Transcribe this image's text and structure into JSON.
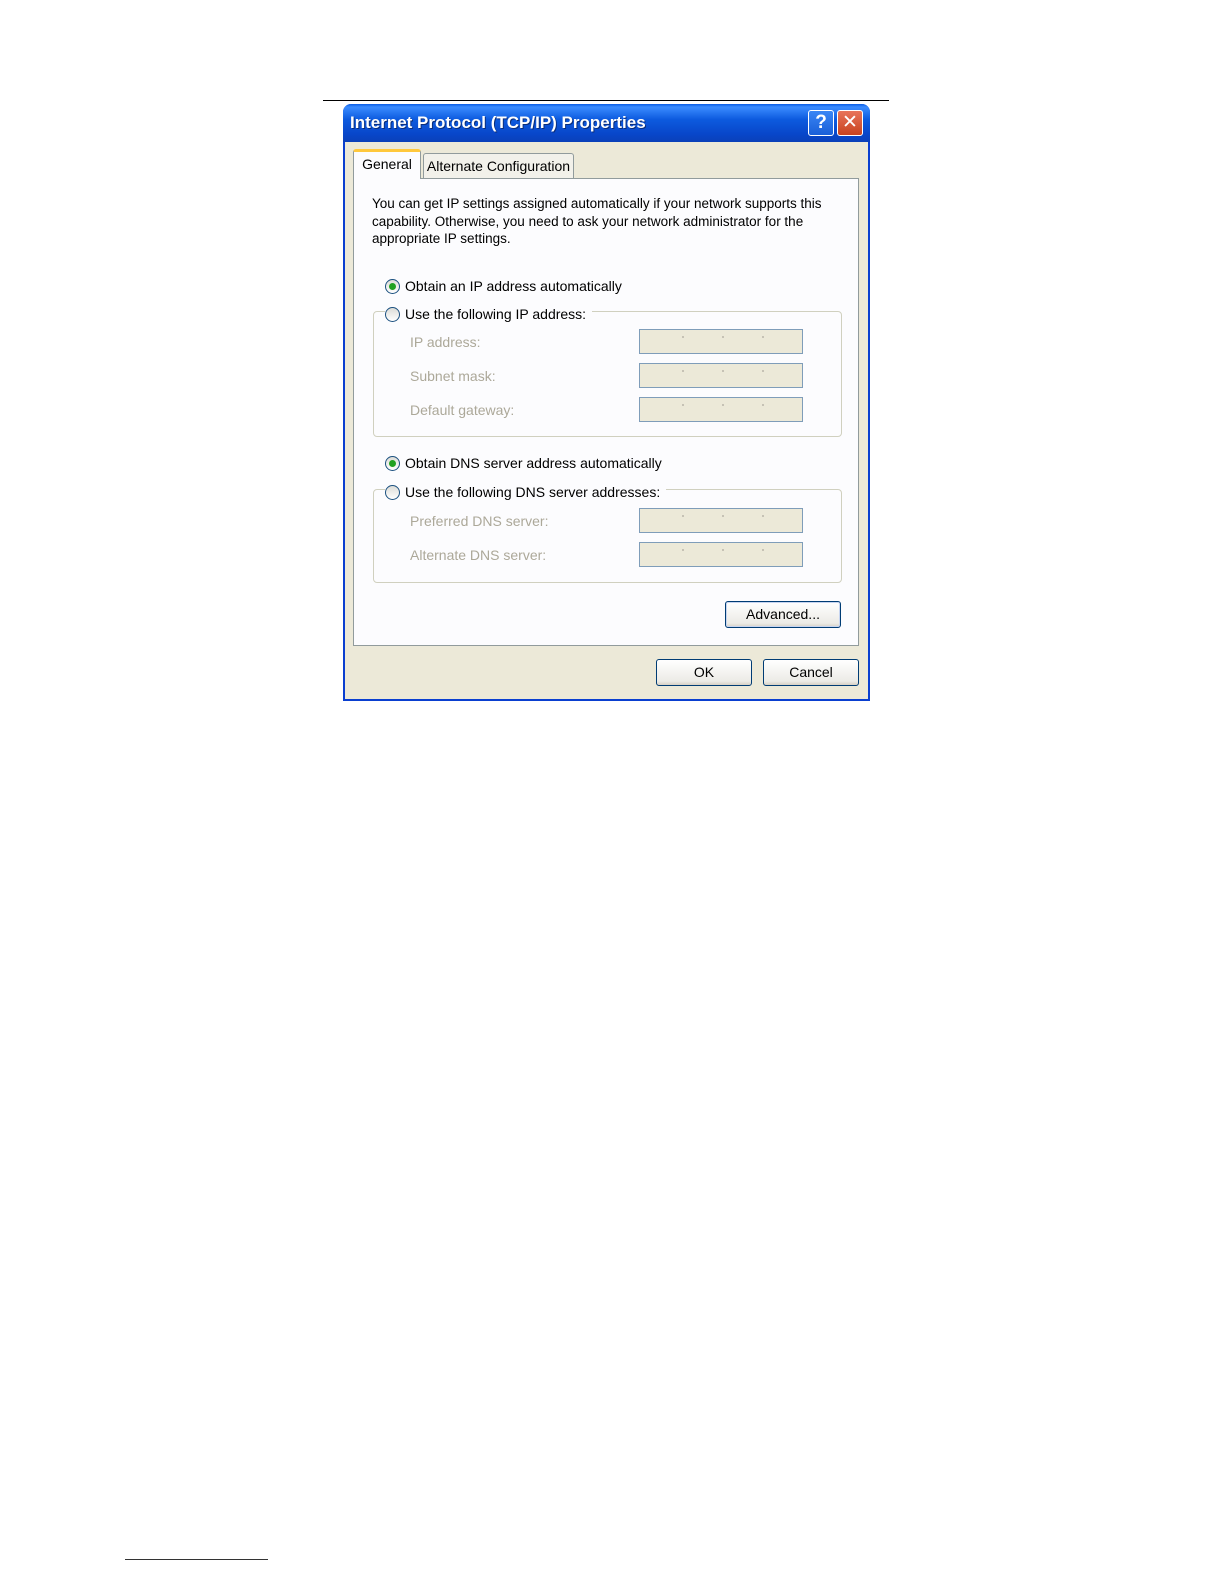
{
  "dialog": {
    "title": "Internet Protocol (TCP/IP) Properties",
    "help_symbol": "?",
    "close_symbol": "✕",
    "tabs": [
      {
        "label": "General",
        "active": true
      },
      {
        "label": "Alternate Configuration",
        "active": false
      }
    ],
    "intro": "You can get IP settings assigned automatically if your network supports this capability. Otherwise, you need to ask your network administrator for the appropriate IP settings.",
    "ip": {
      "auto_label": "Obtain an IP address automatically",
      "manual_label": "Use the following IP address:",
      "selected": "auto",
      "fields": [
        {
          "label": "IP address:"
        },
        {
          "label": "Subnet mask:"
        },
        {
          "label": "Default gateway:"
        }
      ]
    },
    "dns": {
      "auto_label": "Obtain DNS server address automatically",
      "manual_label": "Use the following DNS server addresses:",
      "selected": "auto",
      "fields": [
        {
          "label": "Preferred DNS server:"
        },
        {
          "label": "Alternate DNS server:"
        }
      ]
    },
    "buttons": {
      "advanced": "Advanced...",
      "ok": "OK",
      "cancel": "Cancel"
    }
  }
}
